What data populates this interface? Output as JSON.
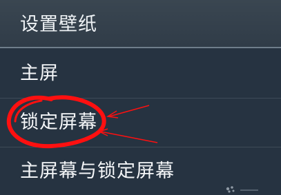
{
  "dialog": {
    "title": "设置壁纸",
    "items": [
      {
        "label": "主屏"
      },
      {
        "label": "锁定屏幕"
      },
      {
        "label": "主屏幕与锁定屏幕"
      }
    ]
  },
  "colors": {
    "background": "#263341",
    "header": "#343f4a",
    "text": "#f4f6f8",
    "annotation": "#ff1010"
  },
  "icons": {
    "annotation_circle": "red-freehand-circle-icon",
    "annotation_arrows": "red-arrow-icon",
    "watermark": "watermark-dots-icon"
  }
}
